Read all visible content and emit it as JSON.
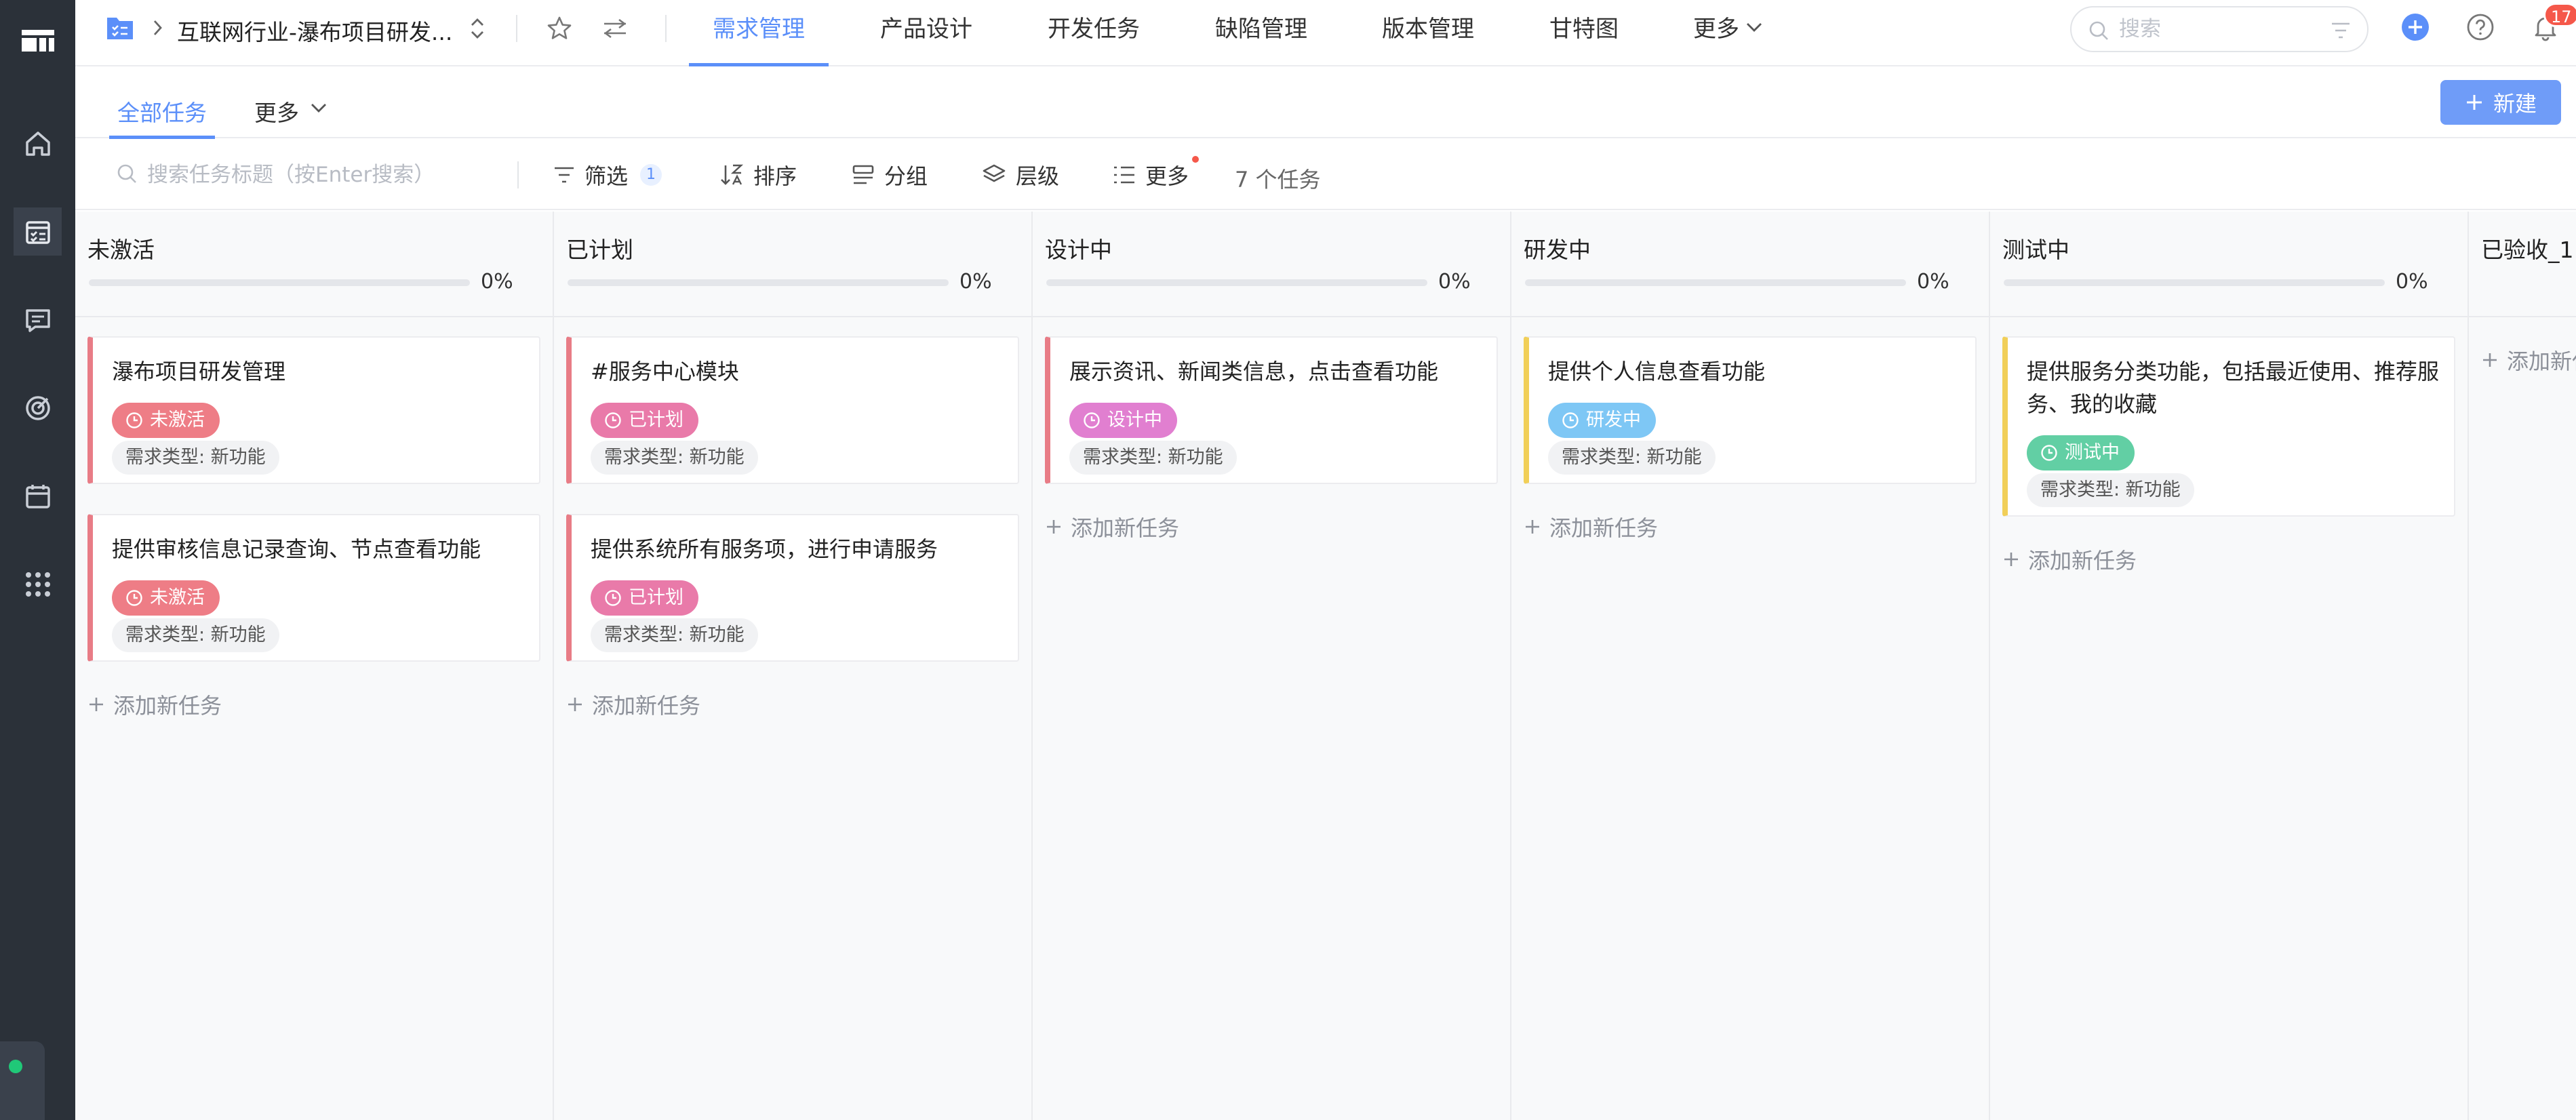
{
  "header": {
    "project_name": "互联网行业-瀑布项目研发...",
    "nav_tabs": [
      {
        "label": "需求管理",
        "active": true
      },
      {
        "label": "产品设计",
        "active": false
      },
      {
        "label": "开发任务",
        "active": false
      },
      {
        "label": "缺陷管理",
        "active": false
      },
      {
        "label": "版本管理",
        "active": false
      },
      {
        "label": "甘特图",
        "active": false
      },
      {
        "label": "更多",
        "active": false
      }
    ],
    "search_placeholder": "搜索",
    "notification_count": "17"
  },
  "subnav": {
    "tabs": [
      {
        "label": "全部任务",
        "active": true
      },
      {
        "label": "更多",
        "active": false
      }
    ],
    "new_button_label": "新建"
  },
  "toolbar": {
    "search_placeholder": "搜索任务标题（按Enter搜索）",
    "filter_label": "筛选",
    "filter_count": "1",
    "sort_label": "排序",
    "group_label": "分组",
    "level_label": "层级",
    "more_label": "更多",
    "task_count": "7 个任务"
  },
  "status_colors": {
    "未激活": "#ee7d86",
    "已计划": "#e97aa9",
    "设计中": "#e17fd0",
    "研发中": "#7ec7f5",
    "测试中": "#62cfa4"
  },
  "card_border_colors": {
    "未激活": "#e87c86",
    "已计划": "#e87c86",
    "设计中": "#e87c86",
    "研发中": "#f1cf58",
    "测试中": "#f1cf58"
  },
  "board": {
    "add_task_label": "添加新任务",
    "columns": [
      {
        "title": "未激活",
        "progress": "0%",
        "cards": [
          {
            "title": "瀑布项目研发管理",
            "status": "未激活",
            "type": "需求类型: 新功能"
          },
          {
            "title": "提供审核信息记录查询、节点查看功能",
            "status": "未激活",
            "type": "需求类型: 新功能"
          }
        ]
      },
      {
        "title": "已计划",
        "progress": "0%",
        "cards": [
          {
            "title": "#服务中心模块",
            "status": "已计划",
            "type": "需求类型: 新功能"
          },
          {
            "title": "提供系统所有服务项，进行申请服务",
            "status": "已计划",
            "type": "需求类型: 新功能"
          }
        ]
      },
      {
        "title": "设计中",
        "progress": "0%",
        "cards": [
          {
            "title": "展示资讯、新闻类信息，点击查看功能",
            "status": "设计中",
            "type": "需求类型: 新功能"
          }
        ]
      },
      {
        "title": "研发中",
        "progress": "0%",
        "cards": [
          {
            "title": "提供个人信息查看功能",
            "status": "研发中",
            "type": "需求类型: 新功能"
          }
        ]
      },
      {
        "title": "测试中",
        "progress": "0%",
        "cards": [
          {
            "title": "提供服务分类功能，包括最近使用、推荐服务、我的收藏",
            "status": "测试中",
            "type": "需求类型: 新功能"
          }
        ]
      },
      {
        "title": "已验收_1",
        "progress": "",
        "cards": []
      }
    ]
  }
}
